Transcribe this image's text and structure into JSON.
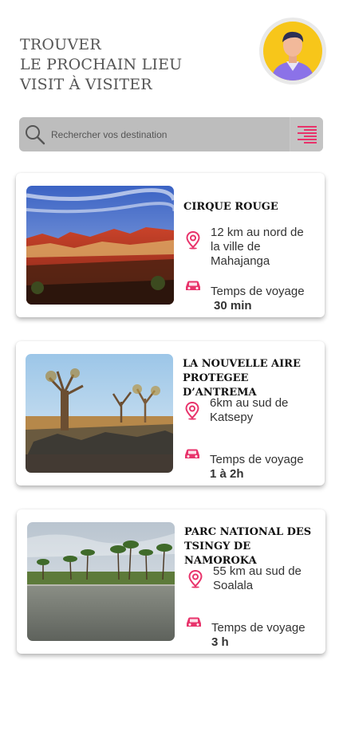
{
  "header": {
    "title_lines": [
      "TROUVER",
      "LE PROCHAIN LIEU",
      "VISIT  À VISITER"
    ]
  },
  "search": {
    "placeholder": "Rechercher vos destination"
  },
  "colors": {
    "accent": "#e8336b",
    "search_bg": "#bdbdbd",
    "avatar_bg": "#f7c61a"
  },
  "destinations": [
    {
      "name": "CIRQUE ROUGE",
      "distance": "12 km au nord de\nla ville de\nMahajanga",
      "travel_label": "Temps de voyage",
      "travel_time": "30 min"
    },
    {
      "name": "LA NOUVELLE AIRE\nPROTEGEE D’ANTREMA",
      "distance": "6km au sud de\nKatsepy",
      "travel_label": "Temps de voyage",
      "travel_time": "1 à 2h"
    },
    {
      "name": "PARC NATIONAL DES\nTSINGY DE NAMOROKA",
      "distance": "55 km au sud de\nSoalala",
      "travel_label": "Temps de voyage",
      "travel_time": "3 h"
    }
  ]
}
